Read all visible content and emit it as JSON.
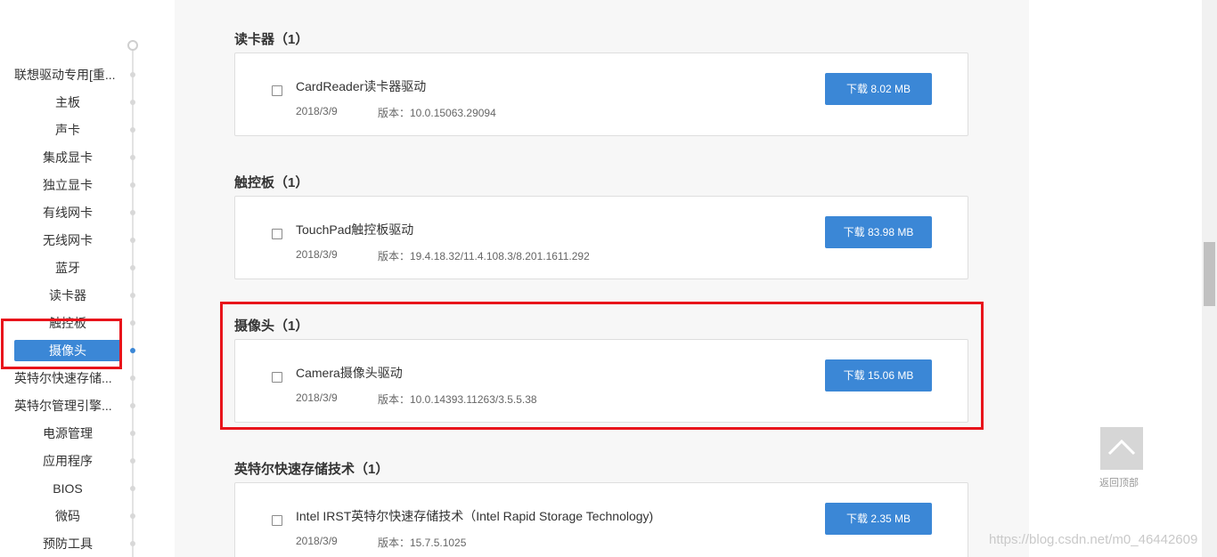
{
  "sidebar": {
    "items": [
      {
        "label": "联想驱动专用[重..."
      },
      {
        "label": "主板"
      },
      {
        "label": "声卡"
      },
      {
        "label": "集成显卡"
      },
      {
        "label": "独立显卡"
      },
      {
        "label": "有线网卡"
      },
      {
        "label": "无线网卡"
      },
      {
        "label": "蓝牙"
      },
      {
        "label": "读卡器"
      },
      {
        "label": "触控板"
      },
      {
        "label": "摄像头",
        "active": true
      },
      {
        "label": "英特尔快速存储..."
      },
      {
        "label": "英特尔管理引擎..."
      },
      {
        "label": "电源管理"
      },
      {
        "label": "应用程序"
      },
      {
        "label": "BIOS"
      },
      {
        "label": "微码"
      },
      {
        "label": "预防工具"
      }
    ]
  },
  "sections": [
    {
      "title": "读卡器（1）",
      "driver": {
        "name": "CardReader读卡器驱动",
        "date": "2018/3/9",
        "version": "版本：10.0.15063.29094",
        "download": "下载 8.02 MB"
      }
    },
    {
      "title": "触控板（1）",
      "driver": {
        "name": "TouchPad触控板驱动",
        "date": "2018/3/9",
        "version": "版本：19.4.18.32/11.4.108.3/8.201.1611.292",
        "download": "下载 83.98 MB"
      }
    },
    {
      "title": "摄像头（1）",
      "driver": {
        "name": "Camera摄像头驱动",
        "date": "2018/3/9",
        "version": "版本：10.0.14393.11263/3.5.5.38",
        "download": "下载 15.06 MB"
      }
    },
    {
      "title": "英特尔快速存储技术（1）",
      "driver": {
        "name": "Intel IRST英特尔快速存储技术（Intel Rapid Storage Technology)",
        "date": "2018/3/9",
        "version": "版本：15.7.5.1025",
        "download": "下载 2.35 MB"
      }
    }
  ],
  "back_to_top": {
    "label": "返回顶部",
    "icon": "chevron-up-icon"
  },
  "watermark": "https://blog.csdn.net/m0_46442609",
  "colors": {
    "accent": "#3b87d6",
    "highlight": "#e8141b"
  }
}
